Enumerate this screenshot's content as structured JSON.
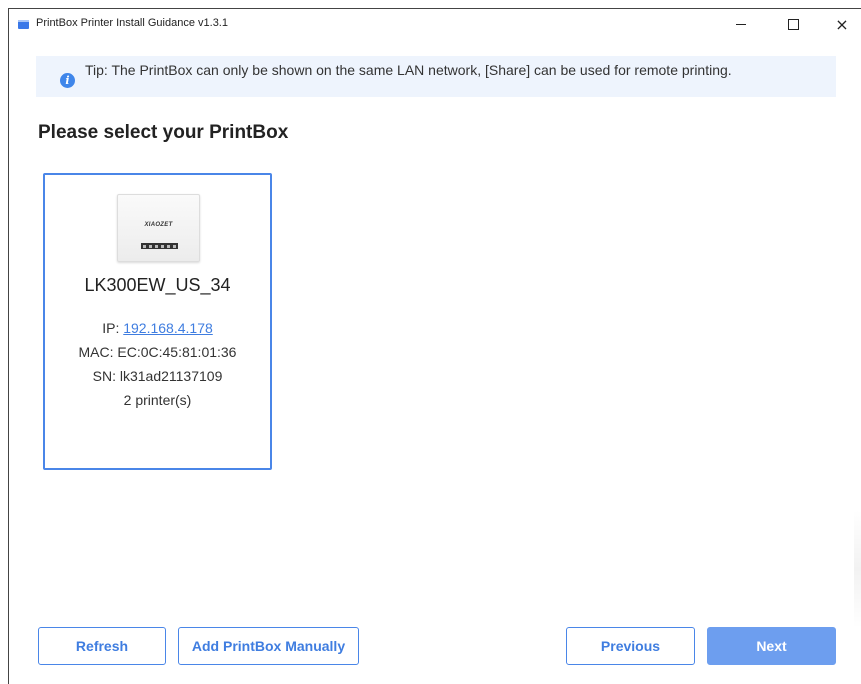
{
  "window": {
    "title": "PrintBox Printer Install Guidance v1.3.1",
    "controls": {
      "minimize": "minimize",
      "maximize": "maximize",
      "close": "×"
    }
  },
  "tip": {
    "icon": "info-icon",
    "text": "Tip:  The PrintBox can only be shown on the same LAN network, [Share] can be used for remote printing."
  },
  "main": {
    "heading": "Please select your PrintBox",
    "devices": [
      {
        "name": "LK300EW_US_34",
        "ip_label": "IP: ",
        "ip": "192.168.4.178",
        "mac": "MAC: EC:0C:45:81:01:36",
        "sn": "SN: lk31ad21137109",
        "printers": "2 printer(s)",
        "image_logo": "XIAOZET",
        "selected": true
      }
    ]
  },
  "footer": {
    "refresh_label": "Refresh",
    "add_label": "Add PrintBox Manually",
    "previous_label": "Previous",
    "next_label": "Next"
  },
  "colors": {
    "accent": "#4a86e8",
    "primary_button": "#6d9eef",
    "tip_background": "#eef4fd",
    "link": "#3f7de0"
  }
}
